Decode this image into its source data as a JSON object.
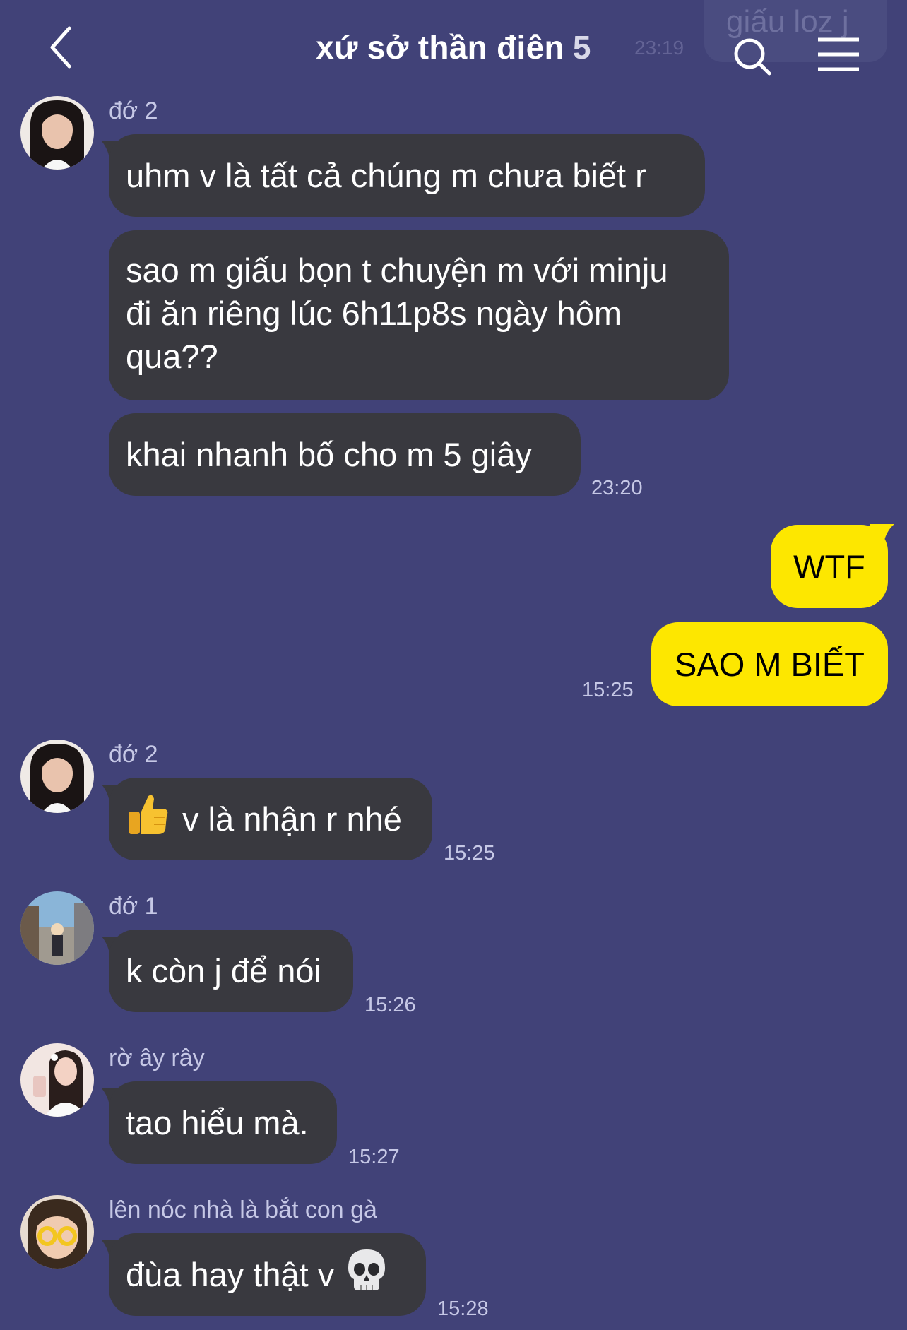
{
  "header": {
    "title": "xứ sở thần điên",
    "member_count": "5",
    "back_icon": "chevron-left-icon",
    "search_icon": "search-icon",
    "menu_icon": "hamburger-menu-icon"
  },
  "ghost_message": {
    "text": "giấu loz j",
    "time": "23:19"
  },
  "colors": {
    "background": "#414278",
    "incoming_bubble": "#39393f",
    "outgoing_bubble": "#fde700",
    "meta_text": "#c6c8e6"
  },
  "messages": [
    {
      "sender": "đớ 2",
      "text": "uhm v là tất cả chúng m chưa biết r"
    },
    {
      "text_lines": [
        "sao m giấu bọn t chuyện m với minju",
        "đi ăn riêng lúc 6h11p8s ngày hôm",
        "qua??"
      ]
    },
    {
      "text": "khai nhanh bố cho m 5 giây",
      "time": "23:20"
    },
    {
      "text": "WTF"
    },
    {
      "text": "SAO M BIẾT",
      "time": "15:25"
    },
    {
      "sender": "đớ 2",
      "text": "v là nhận r nhé",
      "time": "15:25",
      "emoji": "thumbs-up-icon"
    },
    {
      "sender": "đớ 1",
      "text": "k còn j để nói",
      "time": "15:26"
    },
    {
      "sender": "rờ ây rây",
      "text": "tao hiểu mà.",
      "time": "15:27"
    },
    {
      "sender": "lên nóc nhà là bắt con gà",
      "text": "đùa hay thật v",
      "time": "15:28",
      "emoji": "skull-icon"
    }
  ]
}
